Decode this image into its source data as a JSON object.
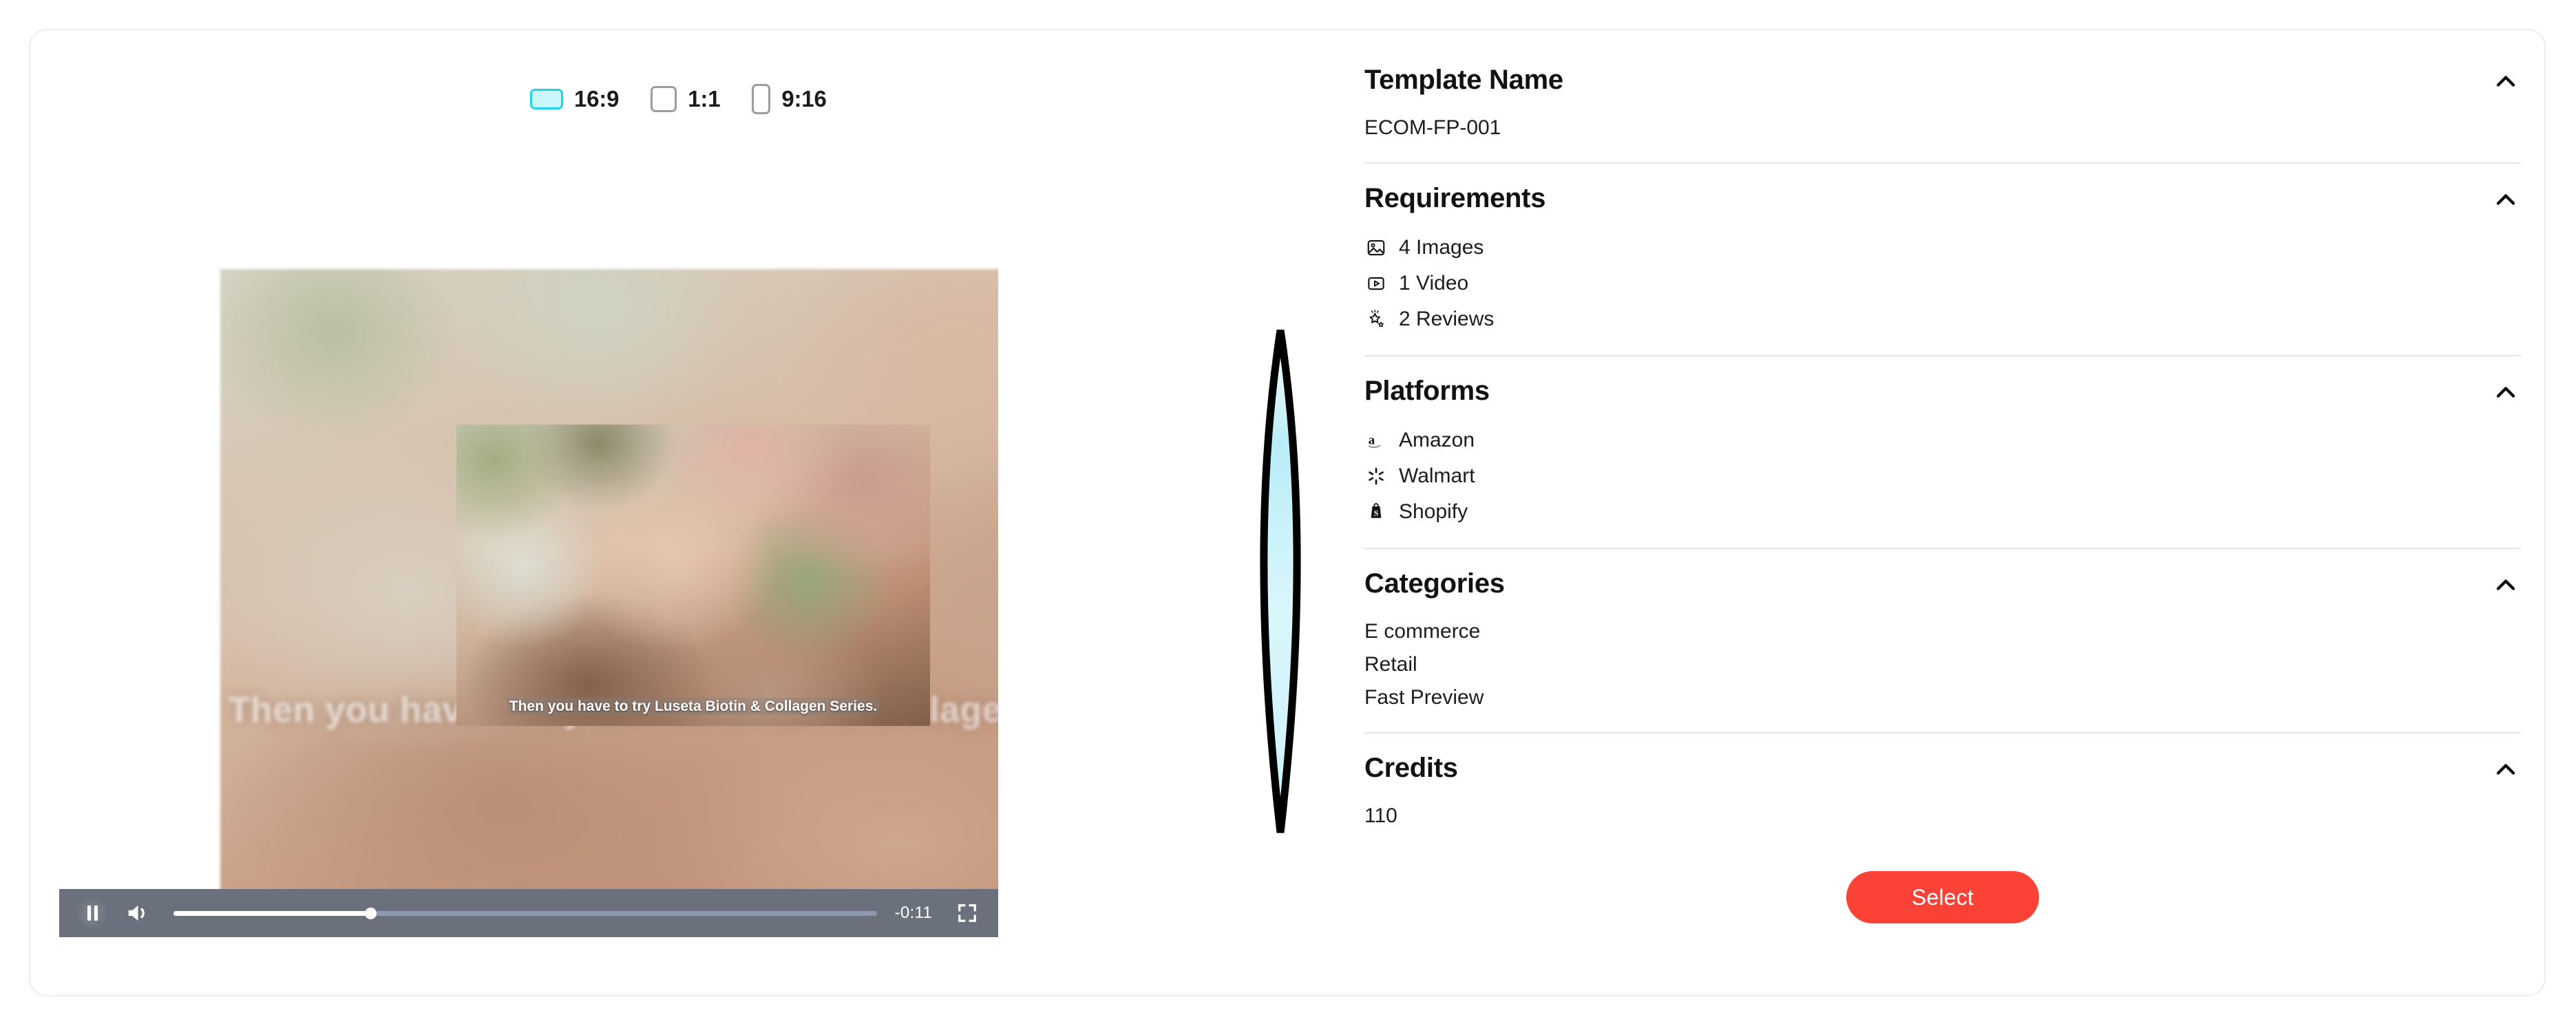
{
  "aspect_ratios": {
    "options": [
      {
        "label": "16:9",
        "selected": true,
        "icon": "rect-16-9-icon"
      },
      {
        "label": "1:1",
        "selected": false,
        "icon": "rect-1-1-icon"
      },
      {
        "label": "9:16",
        "selected": false,
        "icon": "rect-9-16-icon"
      }
    ]
  },
  "video": {
    "caption": "Then you have to try Luseta Biotin & Collagen Series.",
    "background_caption": "Then you have to try Luseta Biotin & Collagen Series.",
    "controls": {
      "pause_label": "Pause",
      "volume_label": "Volume",
      "time_remaining": "-0:11",
      "fullscreen_label": "Fullscreen",
      "progress_percent": 28
    }
  },
  "panel": {
    "sections": [
      {
        "title": "Template Name",
        "values": [
          "ECOM-FP-001"
        ]
      },
      {
        "title": "Requirements",
        "items": [
          {
            "label": "4 Images",
            "icon": "image-icon"
          },
          {
            "label": "1 Video",
            "icon": "video-icon"
          },
          {
            "label": "2 Reviews",
            "icon": "sparkle-stars-icon"
          }
        ]
      },
      {
        "title": "Platforms",
        "items": [
          {
            "label": "Amazon",
            "icon": "amazon-icon"
          },
          {
            "label": "Walmart",
            "icon": "walmart-spark-icon"
          },
          {
            "label": "Shopify",
            "icon": "shopify-bag-icon"
          }
        ]
      },
      {
        "title": "Categories",
        "values": [
          "E commerce",
          "Retail",
          "Fast Preview"
        ]
      },
      {
        "title": "Credits",
        "values": [
          "110"
        ]
      }
    ],
    "select_button": "Select"
  },
  "colors": {
    "accent_red": "#fb4237",
    "selected_swatch_fill": "#c9f7fb",
    "selected_swatch_border": "#22d3ee",
    "control_bar": "#6b717c",
    "divider": "#e4e4e4"
  }
}
